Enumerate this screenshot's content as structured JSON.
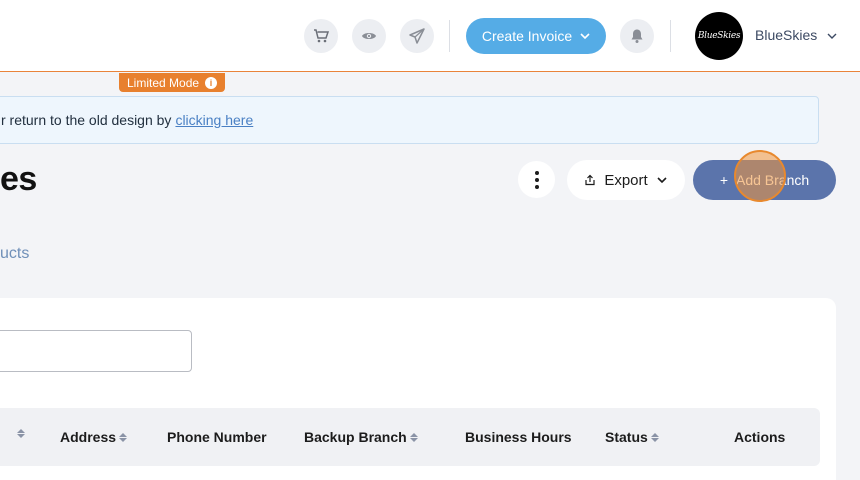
{
  "header": {
    "icons": [
      "cart-icon",
      "eye-icon",
      "send-icon",
      "bell-icon"
    ],
    "create_invoice_label": "Create Invoice",
    "account_name": "BlueSkies",
    "avatar_text": "BlueSkies"
  },
  "limited_mode": {
    "label": "Limited Mode",
    "info": "i"
  },
  "banner": {
    "text": "r return to the old design by",
    "link": "clicking here"
  },
  "page": {
    "title": "es",
    "tab": "ucts"
  },
  "actions": {
    "export_label": "Export",
    "add_label": "Add Branch",
    "add_prefix": "+"
  },
  "search": {
    "value": "",
    "placeholder": ""
  },
  "table": {
    "columns": [
      {
        "label": "",
        "sortable": true
      },
      {
        "label": "Address",
        "sortable": true
      },
      {
        "label": "Phone Number",
        "sortable": false
      },
      {
        "label": "Backup Branch",
        "sortable": true
      },
      {
        "label": "Business Hours",
        "sortable": false
      },
      {
        "label": "Status",
        "sortable": true
      },
      {
        "label": "Actions",
        "sortable": false
      }
    ]
  },
  "colors": {
    "accent": "#55ace6",
    "primary_button": "#5b74ab",
    "limited_mode": "#e8802e",
    "link": "#4a80c4"
  }
}
